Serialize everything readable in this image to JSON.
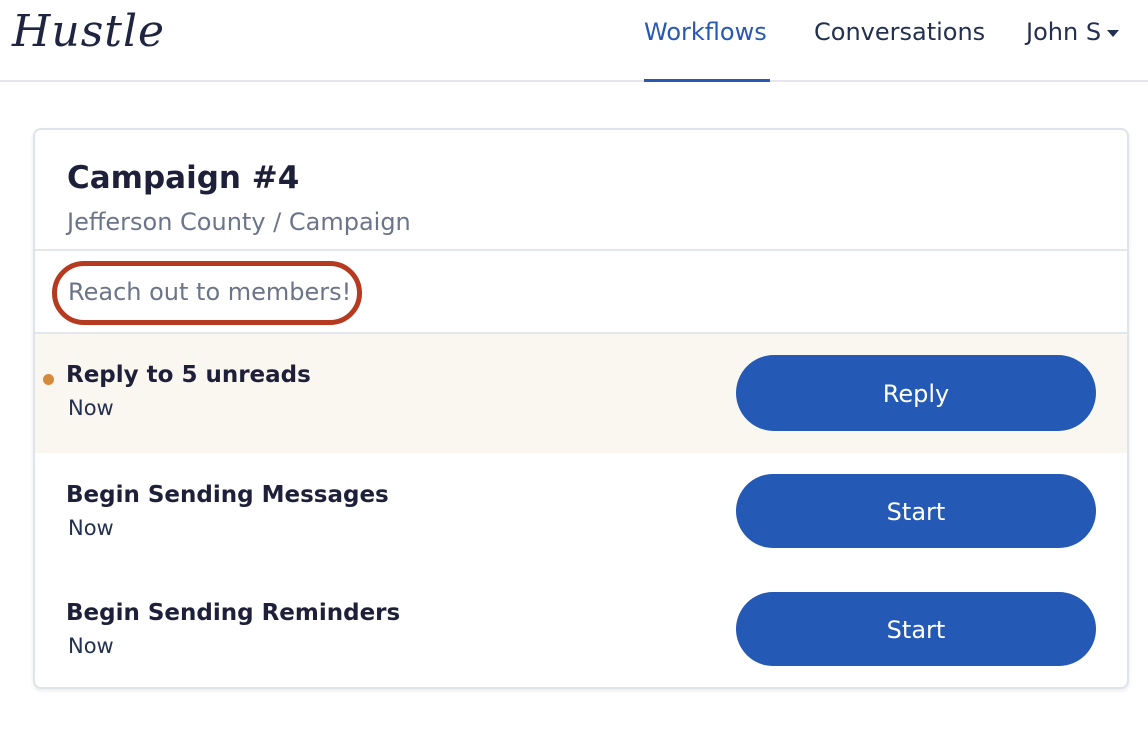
{
  "header": {
    "logo": "Hustle",
    "nav": {
      "workflows": "Workflows",
      "conversations": "Conversations",
      "user": "John S"
    },
    "accent_color": "#2758b3"
  },
  "campaign": {
    "title": "Campaign #4",
    "breadcrumb": "Jefferson County / Campaign",
    "description": "Reach out to members!",
    "highlight_color": "#b53a1f"
  },
  "tasks": [
    {
      "title": "Reply to 5 unreads",
      "time": "Now",
      "button": "Reply",
      "unread": true
    },
    {
      "title": "Begin Sending Messages",
      "time": "Now",
      "button": "Start",
      "unread": false
    },
    {
      "title": "Begin Sending Reminders",
      "time": "Now",
      "button": "Start",
      "unread": false
    }
  ],
  "colors": {
    "button": "#2459b5",
    "unread_dot": "#d48a3c",
    "unread_row_bg": "#faf6f0"
  }
}
